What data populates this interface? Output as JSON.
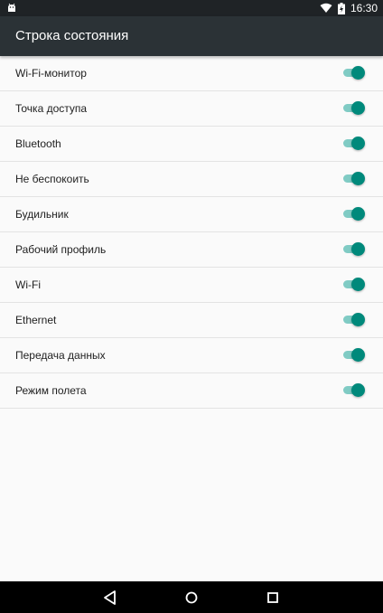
{
  "status_bar": {
    "notification_icon": "android-icon",
    "wifi_icon": "wifi-icon",
    "battery_icon": "battery-icon",
    "time": "16:30"
  },
  "app_bar": {
    "title": "Строка состояния"
  },
  "colors": {
    "app_bar": "#2b3236",
    "status_bar": "#1f2326",
    "switch_on_thumb": "#00897b",
    "switch_on_track": "#80cbc4"
  },
  "items": [
    {
      "label": "Wi-Fi-монитор",
      "enabled": true
    },
    {
      "label": "Точка доступа",
      "enabled": true
    },
    {
      "label": "Bluetooth",
      "enabled": true
    },
    {
      "label": "Не беспокоить",
      "enabled": true
    },
    {
      "label": "Будильник",
      "enabled": true
    },
    {
      "label": "Рабочий профиль",
      "enabled": true
    },
    {
      "label": "Wi-Fi",
      "enabled": true
    },
    {
      "label": "Ethernet",
      "enabled": true
    },
    {
      "label": "Передача данных",
      "enabled": true
    },
    {
      "label": "Режим полета",
      "enabled": true
    }
  ],
  "nav_bar": {
    "back_icon": "back-triangle-icon",
    "home_icon": "home-circle-icon",
    "recents_icon": "recents-square-icon"
  }
}
